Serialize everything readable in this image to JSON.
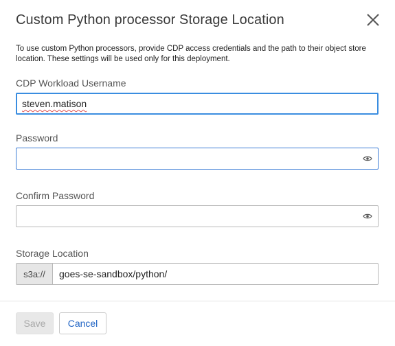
{
  "dialog": {
    "title": "Custom Python processor Storage Location",
    "description": "To use custom Python processors, provide CDP access credentials and the path to their object store location. These settings will be used only for this deployment.",
    "close_icon": "close-icon"
  },
  "fields": {
    "username": {
      "label": "CDP Workload Username",
      "value": "steven.matison"
    },
    "password": {
      "label": "Password",
      "value": "",
      "icon": "eye-icon"
    },
    "confirm_password": {
      "label": "Confirm Password",
      "value": "",
      "icon": "eye-icon"
    },
    "storage_location": {
      "label": "Storage Location",
      "prefix": "s3a://",
      "value": "goes-se-sandbox/python/"
    }
  },
  "footer": {
    "save_label": "Save",
    "cancel_label": "Cancel"
  },
  "colors": {
    "focus_border": "#3a8de0",
    "link_blue": "#1f63c4",
    "disabled_text": "#a8a8a8"
  }
}
